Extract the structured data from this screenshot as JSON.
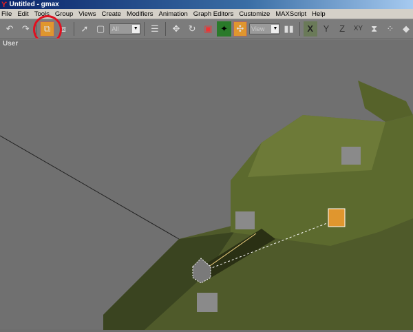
{
  "window": {
    "title": "Untitled - gmax"
  },
  "menu": [
    "File",
    "Edit",
    "Tools",
    "Group",
    "Views",
    "Create",
    "Modifiers",
    "Animation",
    "Graph Editors",
    "Customize",
    "MAXScript",
    "Help"
  ],
  "toolbar": {
    "selection_filter": "All",
    "reference_coord": "View",
    "axis_x": "X",
    "axis_y": "Y",
    "axis_z": "Z",
    "axis_xy": "XY"
  },
  "viewport": {
    "label": "User"
  },
  "colors": {
    "accent": "#e0962e",
    "highlight_ring": "#e01020"
  }
}
